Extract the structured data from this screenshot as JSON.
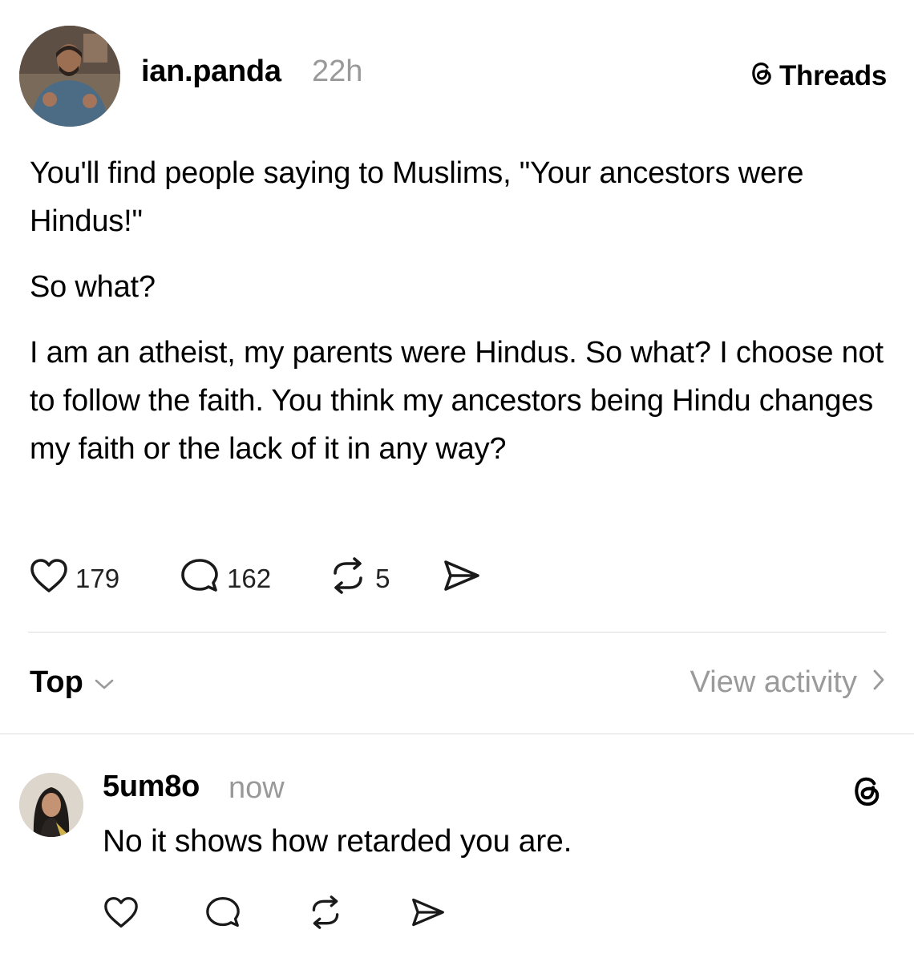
{
  "post": {
    "author": "ian.panda",
    "time": "22h",
    "platform": "Threads",
    "paragraphs": [
      "You'll find people saying to Muslims, \"Your ancestors were Hindus!\"",
      "So what?",
      "I am an atheist, my parents were Hindus. So what? I choose not to follow the faith. You think my ancestors being Hindu changes my faith or the lack of it in any way?"
    ],
    "stats": {
      "likes": "179",
      "replies": "162",
      "reposts": "5"
    }
  },
  "sort": {
    "label": "Top",
    "view_activity": "View activity"
  },
  "reply": {
    "author": "5um8o",
    "time": "now",
    "text": "No it shows how retarded you are."
  },
  "icons": {
    "like": "heart-icon",
    "reply": "comment-icon",
    "repost": "repost-icon",
    "share": "send-icon",
    "platform": "threads-logo-icon",
    "sort_chevron": "chevron-down-icon",
    "activity_chevron": "chevron-right-icon"
  },
  "colors": {
    "text": "#000000",
    "muted": "#999999",
    "divider": "#dcdcdc"
  }
}
